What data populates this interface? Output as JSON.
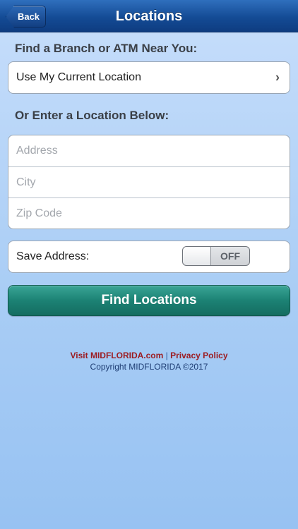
{
  "navbar": {
    "back_label": "Back",
    "title": "Locations"
  },
  "nearby": {
    "heading": "Find a Branch or ATM Near You:",
    "current_location_label": "Use My Current Location",
    "chevron": "›"
  },
  "manual": {
    "heading": "Or Enter a Location Below:",
    "address_placeholder": "Address",
    "city_placeholder": "City",
    "zip_placeholder": "Zip Code"
  },
  "save_address": {
    "label": "Save Address:",
    "toggle_state": "OFF"
  },
  "find_button": {
    "label": "Find Locations"
  },
  "footer": {
    "visit_link": "Visit MIDFLORIDA.com",
    "separator": "|",
    "privacy_link": "Privacy Policy",
    "copyright": "Copyright MIDFLORIDA ©2017"
  },
  "colors": {
    "navbar": "#144b95",
    "find_button": "#1c8274",
    "footer_link": "#9c1d22"
  }
}
